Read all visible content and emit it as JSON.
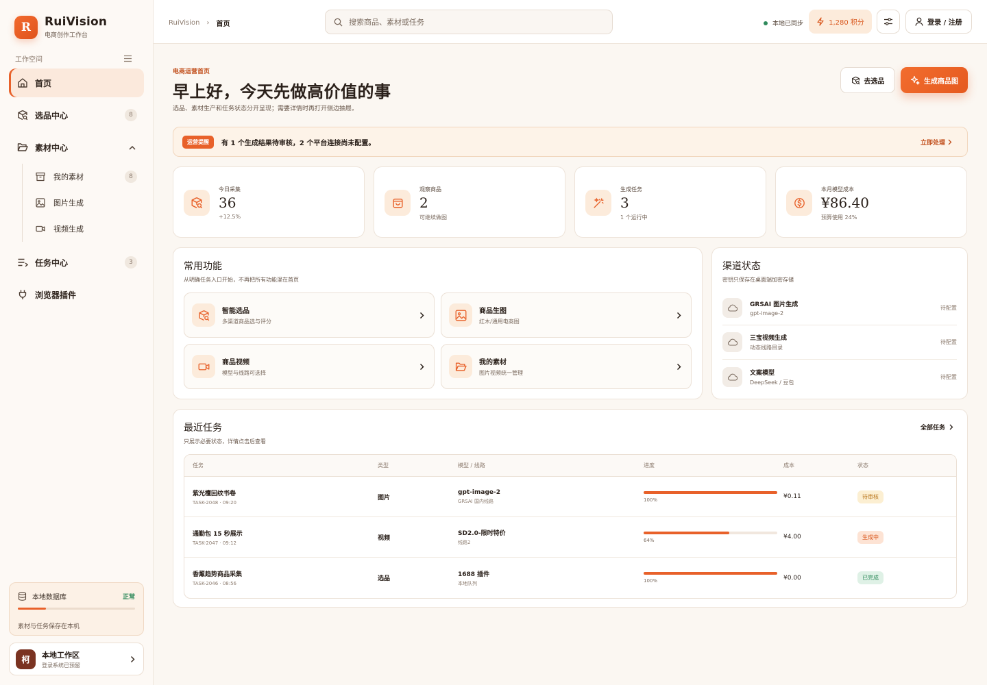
{
  "brand": {
    "logo_letter": "R",
    "name": "RuiVision",
    "subtitle": "电商创作工作台"
  },
  "sidebar": {
    "workspace_label": "工作空间",
    "items": [
      {
        "label": "首页",
        "icon": "home-icon",
        "active": true
      },
      {
        "label": "选品中心",
        "icon": "package-search-icon",
        "badge": "8"
      },
      {
        "label": "素材中心",
        "icon": "folder-open-icon",
        "expanded": true,
        "children": [
          {
            "label": "我的素材",
            "icon": "archive-icon",
            "badge": "8"
          },
          {
            "label": "图片生成",
            "icon": "image-icon"
          },
          {
            "label": "视频生成",
            "icon": "video-icon"
          }
        ]
      },
      {
        "label": "任务中心",
        "icon": "list-icon",
        "badge": "3"
      },
      {
        "label": "浏览器插件",
        "icon": "plug-icon"
      }
    ],
    "db": {
      "label": "本地数据库",
      "status": "正常",
      "note": "素材与任务保存在本机",
      "usage": 0.24
    },
    "user": {
      "avatar_text": "柯",
      "name": "本地工作区",
      "sub": "登录系统已预留"
    }
  },
  "topbar": {
    "breadcrumb": [
      "RuiVision",
      "首页"
    ],
    "search_placeholder": "搜索商品、素材或任务",
    "sync_text": "本地已同步",
    "points": "1,280 积分",
    "login": "登录 / 注册"
  },
  "page": {
    "eyebrow": "电商运营首页",
    "title": "早上好，今天先做高价值的事",
    "subtitle": "选品、素材生产和任务状态分开呈现；需要详情时再打开侧边抽屉。",
    "btn_pick": "去选品",
    "btn_generate": "生成商品图"
  },
  "alert": {
    "tag": "运营提醒",
    "text": "有 1 个生成结果待审核，2 个平台连接尚未配置。",
    "link": "立即处理"
  },
  "stats": [
    {
      "label": "今日采集",
      "value": "36",
      "note": "+12.5%",
      "icon": "package-search-icon"
    },
    {
      "label": "观察商品",
      "value": "2",
      "note": "可继续做图",
      "icon": "shopping-bag-icon"
    },
    {
      "label": "生成任务",
      "value": "3",
      "note": "1 个运行中",
      "icon": "magic-wand-icon"
    },
    {
      "label": "本月模型成本",
      "value": "¥86.40",
      "note": "预算使用 24%",
      "icon": "dollar-circle-icon"
    }
  ],
  "functions": {
    "title": "常用功能",
    "subtitle": "从明确任务入口开始，不再把所有功能混在首页",
    "items": [
      {
        "name": "智能选品",
        "desc": "多渠道商品选与评分",
        "icon": "package-search-icon"
      },
      {
        "name": "商品生图",
        "desc": "红木/通用电商图",
        "icon": "image-icon"
      },
      {
        "name": "商品视频",
        "desc": "模型与线路可选择",
        "icon": "video-icon"
      },
      {
        "name": "我的素材",
        "desc": "图片视频统一管理",
        "icon": "folder-open-icon"
      }
    ]
  },
  "channels": {
    "title": "渠道状态",
    "subtitle": "密钥只保存在桌面端加密存储",
    "items": [
      {
        "name": "GRSAI 图片生成",
        "desc": "gpt-image-2",
        "status": "待配置"
      },
      {
        "name": "三宝视频生成",
        "desc": "动态线路目录",
        "status": "待配置"
      },
      {
        "name": "文案模型",
        "desc": "DeepSeek / 豆包",
        "status": "待配置"
      }
    ]
  },
  "tasks": {
    "title": "最近任务",
    "subtitle": "只展示必要状态，详情点击后查看",
    "all_link": "全部任务",
    "headers": [
      "任务",
      "类型",
      "模型 / 线路",
      "进度",
      "成本",
      "状态"
    ],
    "rows": [
      {
        "name": "紫光檀回纹书卷",
        "id": "TASK-2048 · 09:20",
        "type": "图片",
        "model": "gpt-image-2",
        "route": "GRSAI 国内线路",
        "progress": 100,
        "progress_label": "100%",
        "cost": "¥0.11",
        "status": "待审核",
        "status_kind": "review"
      },
      {
        "name": "通勤包 15 秒展示",
        "id": "TASK-2047 · 09:12",
        "type": "视频",
        "model": "SD2.0-限时特价",
        "route": "线路2",
        "progress": 64,
        "progress_label": "64%",
        "cost": "¥4.00",
        "status": "生成中",
        "status_kind": "gen"
      },
      {
        "name": "香薰趋势商品采集",
        "id": "TASK-2046 · 08:56",
        "type": "选品",
        "model": "1688 插件",
        "route": "本地队列",
        "progress": 100,
        "progress_label": "100%",
        "cost": "¥0.00",
        "status": "已完成",
        "status_kind": "done"
      }
    ]
  }
}
